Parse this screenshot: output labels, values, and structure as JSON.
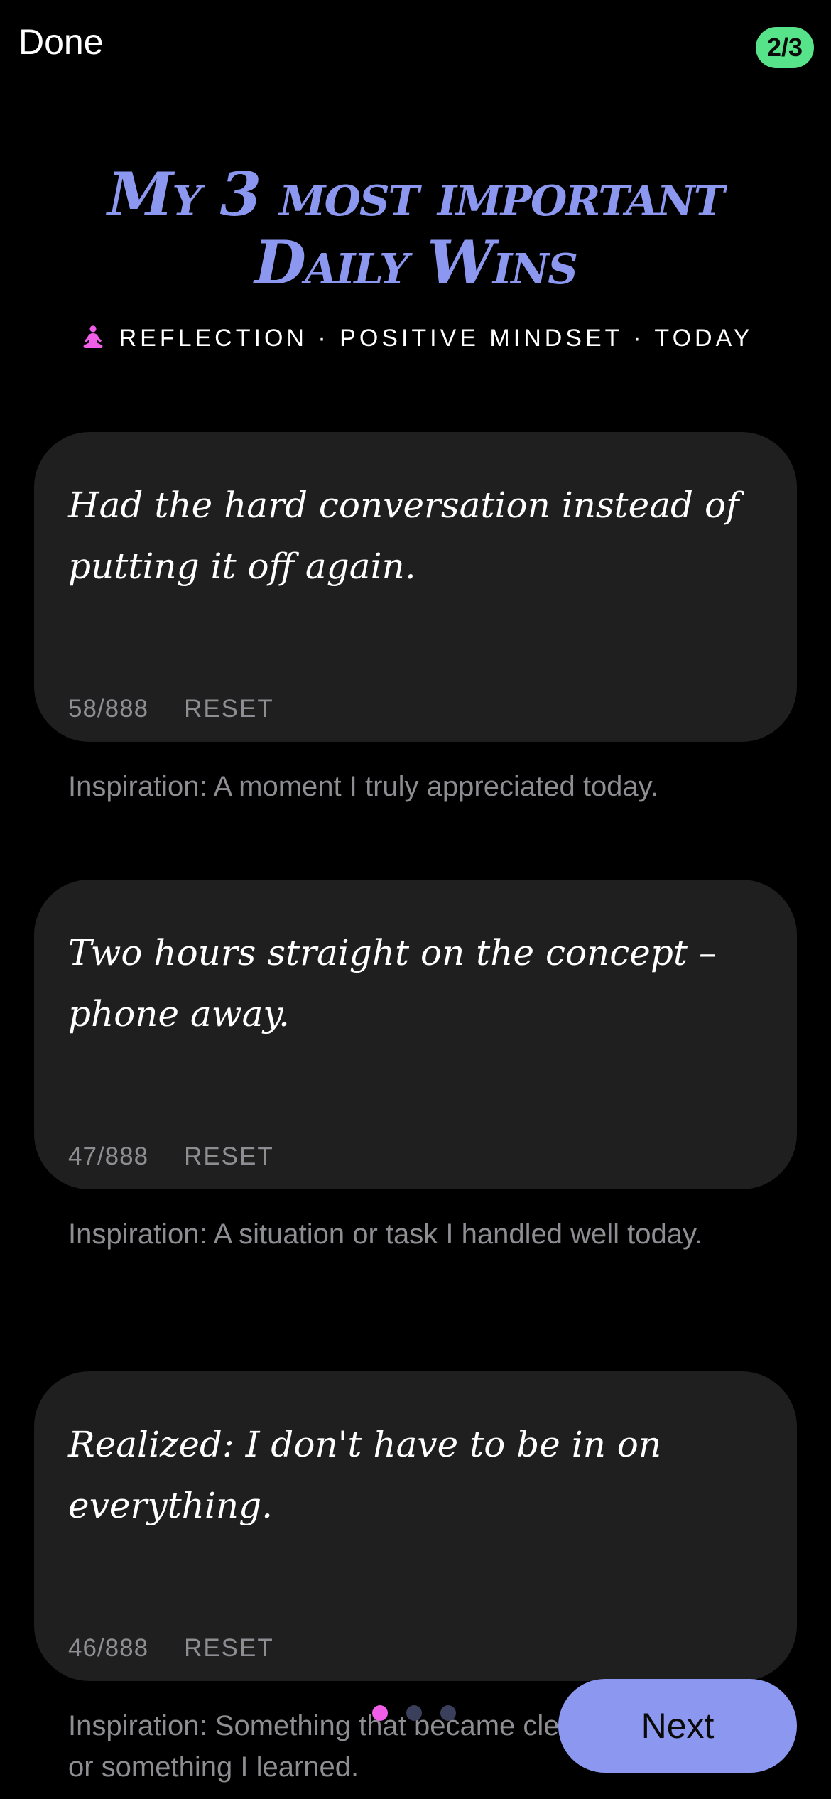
{
  "header": {
    "done_label": "Done",
    "step_badge": "2/3"
  },
  "title": "My 3 most important Daily Wins",
  "subtitle": "REFLECTION · POSITIVE MINDSET · TODAY",
  "subtitle_icon": "meditation-icon",
  "entries": [
    {
      "text": "Had the hard conversation instead of putting it off again.",
      "count": "58/888",
      "reset_label": "RESET",
      "inspiration": "Inspiration: A moment I truly appreciated today."
    },
    {
      "text": "Two hours straight on the concept – phone away.",
      "count": "47/888",
      "reset_label": "RESET",
      "inspiration": "Inspiration: A situation or task I handled well today."
    },
    {
      "text": "Realized: I don't have to be in on everything.",
      "count": "46/888",
      "reset_label": "RESET",
      "inspiration": "Inspiration: Something that became clear to me today, or something I learned."
    }
  ],
  "pagination": {
    "pages": 3,
    "active_index": 0
  },
  "next_label": "Next",
  "colors": {
    "background": "#000000",
    "card": "#1f1f1f",
    "accent": "#8c98ef",
    "badge": "#57e389",
    "active_dot": "#f05ee8",
    "muted_text": "#8d8d92"
  }
}
